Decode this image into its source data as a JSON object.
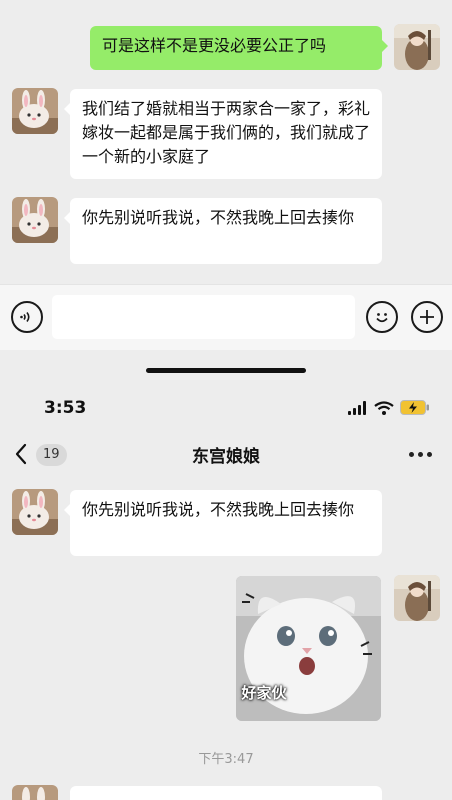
{
  "top_chat": {
    "messages": [
      {
        "side": "right",
        "text": "可是这样不是更没必要公正了吗"
      },
      {
        "side": "left",
        "text": "我们结了婚就相当于两家合一家了，彩礼嫁妆一起都是属于我们俩的，我们就成了一个新的小家庭了"
      },
      {
        "side": "left",
        "text": "你先别说听我说，不然我晚上回去揍你"
      }
    ],
    "input_bar": {
      "voice_icon": "voice-icon",
      "emoji_icon": "emoji-icon",
      "plus_icon": "plus-icon"
    }
  },
  "status_bar": {
    "time": "3:53",
    "icons": [
      "signal-icon",
      "wifi-icon",
      "battery-charging-icon"
    ]
  },
  "navbar": {
    "back_icon": "chevron-left-icon",
    "unread_count": "19",
    "title": "东宫娘娘",
    "more_icon": "more-icon"
  },
  "bottom_chat": {
    "messages": [
      {
        "side": "left",
        "text": "你先别说听我说，不然我晚上回去揍你"
      },
      {
        "side": "right",
        "type": "sticker",
        "caption": "好家伙"
      }
    ],
    "timestamp": "下午3:47"
  }
}
